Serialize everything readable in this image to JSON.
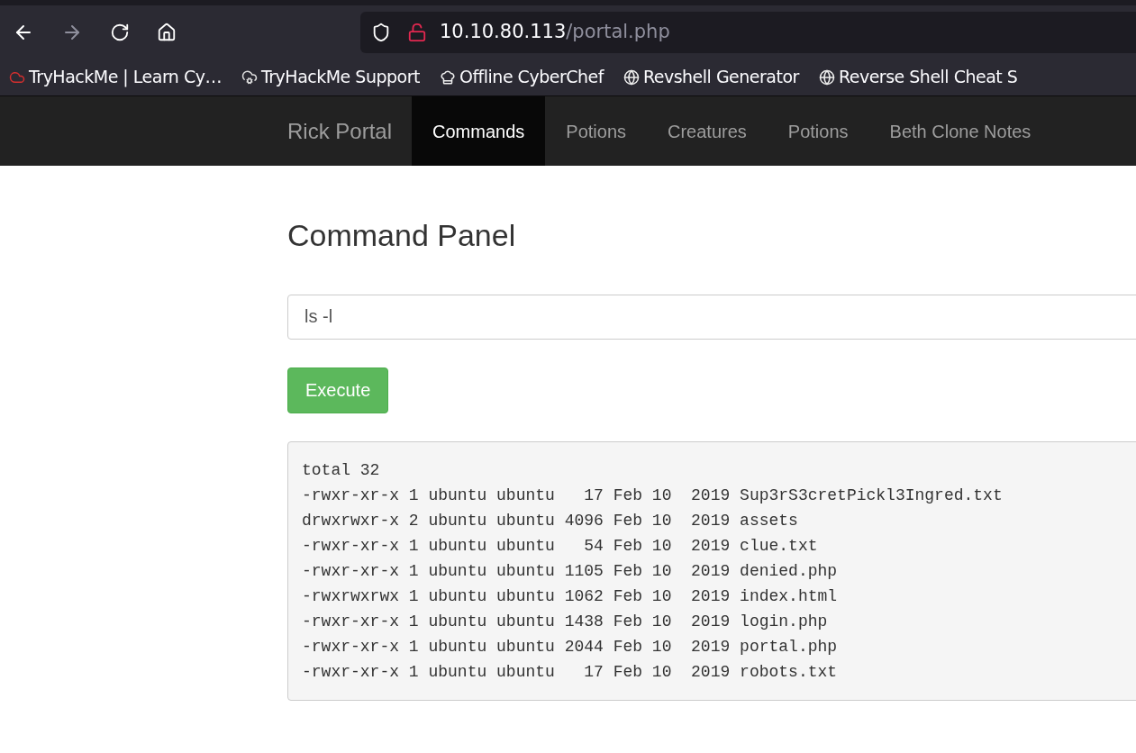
{
  "browser": {
    "address": {
      "host": "10.10.80.113",
      "path": "/portal.php"
    },
    "bookmarks": [
      {
        "kind": "cloud",
        "label": "TryHackMe | Learn Cy…"
      },
      {
        "kind": "support",
        "label": "TryHackMe Support"
      },
      {
        "kind": "chef",
        "label": "Offline CyberChef"
      },
      {
        "kind": "globe",
        "label": "Revshell Generator"
      },
      {
        "kind": "globe",
        "label": "Reverse Shell Cheat S"
      }
    ]
  },
  "navbar": {
    "brand": "Rick Portal",
    "items": [
      {
        "label": "Commands",
        "selected": true
      },
      {
        "label": "Potions",
        "selected": false
      },
      {
        "label": "Creatures",
        "selected": false
      },
      {
        "label": "Potions",
        "selected": false
      },
      {
        "label": "Beth Clone Notes",
        "selected": false
      }
    ]
  },
  "page": {
    "heading": "Command Panel",
    "command": {
      "value": "ls -l"
    },
    "button": "Execute",
    "output": [
      "total 32",
      "-rwxr-xr-x 1 ubuntu ubuntu   17 Feb 10  2019 Sup3rS3cretPickl3Ingred.txt",
      "drwxrwxr-x 2 ubuntu ubuntu 4096 Feb 10  2019 assets",
      "-rwxr-xr-x 1 ubuntu ubuntu   54 Feb 10  2019 clue.txt",
      "-rwxr-xr-x 1 ubuntu ubuntu 1105 Feb 10  2019 denied.php",
      "-rwxrwxrwx 1 ubuntu ubuntu 1062 Feb 10  2019 index.html",
      "-rwxr-xr-x 1 ubuntu ubuntu 1438 Feb 10  2019 login.php",
      "-rwxr-xr-x 1 ubuntu ubuntu 2044 Feb 10  2019 portal.php",
      "-rwxr-xr-x 1 ubuntu ubuntu   17 Feb 10  2019 robots.txt"
    ]
  }
}
